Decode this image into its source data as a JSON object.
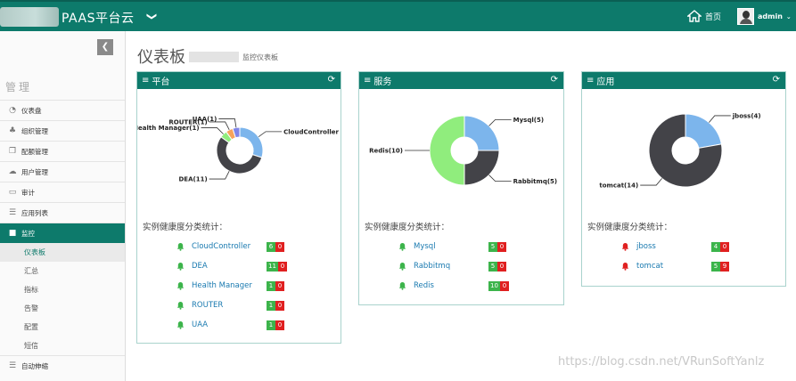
{
  "header": {
    "brand": "PAAS平台云",
    "caret": "❯",
    "home_label": "首页",
    "user_label": "admin"
  },
  "sidebar": {
    "collapse": "❮",
    "section_title": "管理",
    "items": [
      {
        "icon": "dashboard-icon",
        "glyph": "◔",
        "label": "仪表盘"
      },
      {
        "icon": "org-icon",
        "glyph": "♣",
        "label": "组织管理"
      },
      {
        "icon": "config-icon",
        "glyph": "❐",
        "label": "配额管理"
      },
      {
        "icon": "cloud-icon",
        "glyph": "☁",
        "label": "用户管理"
      },
      {
        "icon": "monitor-icon",
        "glyph": "▭",
        "label": "审计"
      },
      {
        "icon": "list-icon",
        "glyph": "☰",
        "label": "应用列表"
      },
      {
        "icon": "video-icon",
        "glyph": "■",
        "label": "监控"
      }
    ],
    "subitems": [
      "仪表板",
      "汇总",
      "指标",
      "告警",
      "配置",
      "短信"
    ],
    "bottom_item": {
      "icon": "list-icon",
      "glyph": "☰",
      "label": "自动伸缩"
    }
  },
  "page": {
    "title": "仪表板",
    "crumb": "监控仪表板"
  },
  "panels": [
    {
      "title": "平台",
      "stats_title": "实例健康度分类统计：",
      "rows": [
        {
          "name": "CloudController",
          "ok": "6",
          "bad": "0"
        },
        {
          "name": "DEA",
          "ok": "11",
          "bad": "0"
        },
        {
          "name": "Health Manager",
          "ok": "1",
          "bad": "0"
        },
        {
          "name": "ROUTER",
          "ok": "1",
          "bad": "0"
        },
        {
          "name": "UAA",
          "ok": "1",
          "bad": "0"
        }
      ]
    },
    {
      "title": "服务",
      "stats_title": "实例健康度分类统计：",
      "rows": [
        {
          "name": "Mysql",
          "ok": "5",
          "bad": "0"
        },
        {
          "name": "Rabbitmq",
          "ok": "5",
          "bad": "0"
        },
        {
          "name": "Redis",
          "ok": "10",
          "bad": "0"
        }
      ]
    },
    {
      "title": "应用",
      "stats_title": "实例健康度分类统计：",
      "rows": [
        {
          "name": "jboss",
          "ok": "4",
          "bad": "0"
        },
        {
          "name": "tomcat",
          "ok": "5",
          "bad": "9"
        }
      ]
    }
  ],
  "chart_data": [
    {
      "type": "pie",
      "labels": [
        "CloudController",
        "DEA",
        "Health Manager",
        "ROUTER",
        "UAA"
      ],
      "values": [
        6,
        11,
        1,
        1,
        1
      ],
      "display": [
        "CloudController",
        "DEA(11)",
        "Health Manager(1)",
        "ROUTER(1)",
        "UAA(1)"
      ]
    },
    {
      "type": "pie",
      "labels": [
        "Mysql",
        "Rabbitmq",
        "Redis"
      ],
      "values": [
        5,
        5,
        10
      ],
      "display": [
        "Mysql(5)",
        "Rabbitmq(5)",
        "Redis(10)"
      ]
    },
    {
      "type": "pie",
      "labels": [
        "jboss",
        "tomcat"
      ],
      "values": [
        4,
        14
      ],
      "display": [
        "jboss(4)",
        "tomcat(14)"
      ]
    }
  ],
  "colors": {
    "brand": "#0d7a6b",
    "blue": "#7cb5ec",
    "dark": "#434348",
    "green": "#90ed7d",
    "orange": "#f7a35c",
    "purple": "#8085e9",
    "ok": "#3cb44b",
    "bad": "#e02020"
  },
  "watermark": "https://blog.csdn.net/VRunSoftYanlz"
}
